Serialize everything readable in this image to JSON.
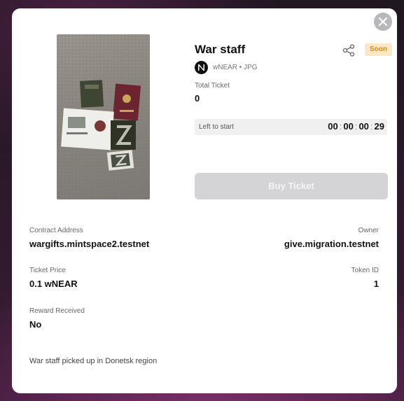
{
  "item": {
    "title": "War staff",
    "status": "Soon",
    "token_meta": "wNEAR • JPG",
    "total_ticket_label": "Total Ticket",
    "total_ticket_value": "0",
    "left_to_start_label": "Left to start",
    "countdown": {
      "days": "00",
      "hours": "00",
      "minutes": "00",
      "seconds": "29"
    },
    "buy_label": "Buy Ticket"
  },
  "details": {
    "contract_label": "Contract Address",
    "contract_value": "wargifts.mintspace2.testnet",
    "owner_label": "Owner",
    "owner_value": "give.migration.testnet",
    "price_label": "Ticket Price",
    "price_value": "0.1 wNEAR",
    "token_id_label": "Token ID",
    "token_id_value": "1",
    "reward_label": "Reward Received",
    "reward_value": "No",
    "description": "War staff picked up in Donetsk region"
  },
  "colors": {
    "badge_bg": "#fde7c4",
    "badge_text": "#d58a1a",
    "button_disabled": "#d4d4d6"
  },
  "icons": [
    "close-icon",
    "share-icon",
    "near-logo-icon"
  ]
}
